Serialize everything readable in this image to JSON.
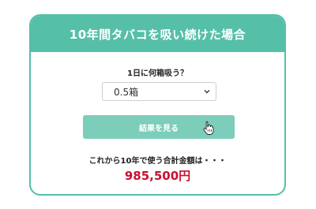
{
  "header": {
    "title": "10年間タバコを吸い続けた場合"
  },
  "form": {
    "question": "1日に何箱吸う？",
    "selected_option": "0.5箱",
    "result_button_label": "結果を見る"
  },
  "result": {
    "label": "これから10年で使う合計金額は・・・",
    "amount": "985,500円"
  },
  "colors": {
    "accent": "#56bfa8",
    "button": "#7ccdb9",
    "amount": "#c8102e"
  }
}
